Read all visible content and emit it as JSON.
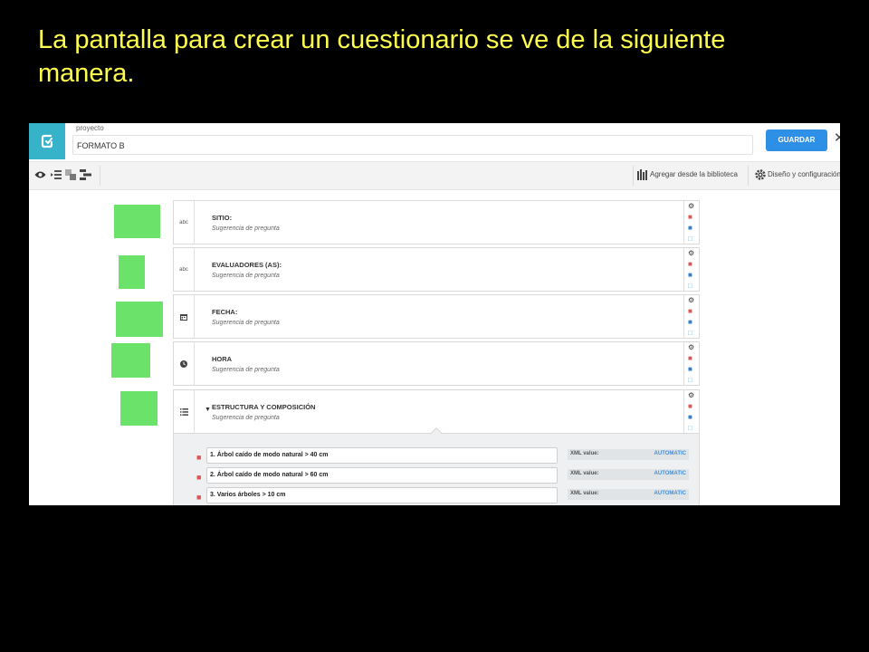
{
  "slide": {
    "title_line1": "La pantalla para crear un cuestionario se ve de la siguiente",
    "title_line2": "manera."
  },
  "app": {
    "project_label": "proyecto",
    "project_name": "FORMATO B",
    "save_label": "GUARDAR",
    "close_label": "✕",
    "brand_color": "#36b3c9",
    "accent_color": "#2e8fe6"
  },
  "toolbar": {
    "add_from_library": "Agregar desde la biblioteca",
    "design_settings": "Diseño y configuración"
  },
  "questions": [
    {
      "type_label": "abc",
      "type_icon": "text-type-icon",
      "label": "SITIO:",
      "hint": "Sugerencia de pregunta"
    },
    {
      "type_label": "abc",
      "type_icon": "text-type-icon",
      "label": "EVALUADORES (AS):",
      "hint": "Sugerencia de pregunta"
    },
    {
      "type_label": "",
      "type_icon": "calendar-icon",
      "label": "FECHA:",
      "hint": "Sugerencia de pregunta"
    },
    {
      "type_label": "",
      "type_icon": "clock-icon",
      "label": "HORA",
      "hint": "Sugerencia de pregunta"
    },
    {
      "type_label": "",
      "type_icon": "list-icon",
      "label": "ESTRUCTURA Y COMPOSICIÓN",
      "hint": "Sugerencia de pregunta"
    }
  ],
  "options": [
    {
      "label": "1. Árbol caído de modo natural > 40 cm",
      "xml_label": "XML value:",
      "xml_value": "AUTOMATIC"
    },
    {
      "label": "2. Árbol caído de modo natural > 60 cm",
      "xml_label": "XML value:",
      "xml_value": "AUTOMATIC"
    },
    {
      "label": "3. Varios árboles > 10 cm",
      "xml_label": "XML value:",
      "xml_value": "AUTOMATIC"
    }
  ]
}
